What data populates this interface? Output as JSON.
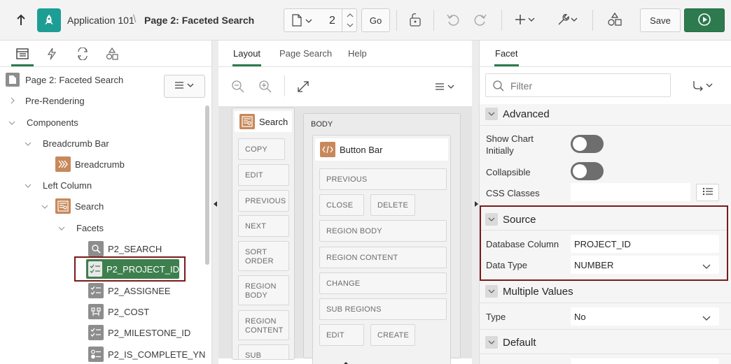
{
  "toolbar": {
    "app_name": "Application 101",
    "page_title": "Page 2: Faceted Search",
    "page_number": "2",
    "go_label": "Go",
    "save_label": "Save",
    "breadcrumb_sep": "\\"
  },
  "left_panel": {
    "root": "Page 2: Faceted Search",
    "nodes": {
      "pre_rendering": "Pre-Rendering",
      "components": "Components",
      "breadcrumb_bar": "Breadcrumb Bar",
      "breadcrumb": "Breadcrumb",
      "left_column": "Left Column",
      "search": "Search",
      "facets": "Facets",
      "f1": "P2_SEARCH",
      "f2": "P2_PROJECT_ID",
      "f3": "P2_ASSIGNEE",
      "f4": "P2_COST",
      "f5": "P2_MILESTONE_ID",
      "f6": "P2_IS_COMPLETE_YN"
    }
  },
  "middle_panel": {
    "tabs": [
      "Layout",
      "Page Search",
      "Help"
    ],
    "search_region": "Search",
    "search_slots": [
      "COPY",
      "EDIT",
      "PREVIOUS",
      "NEXT",
      "SORT ORDER",
      "REGION BODY",
      "REGION CONTENT",
      "SUB"
    ],
    "body_label": "BODY",
    "button_bar": "Button Bar",
    "bb_slots": {
      "previous": "PREVIOUS",
      "close": "CLOSE",
      "delete": "DELETE",
      "region_body": "REGION BODY",
      "region_content": "REGION CONTENT",
      "change": "CHANGE",
      "sub_regions": "SUB REGIONS",
      "edit": "EDIT",
      "create": "CREATE"
    }
  },
  "right_panel": {
    "tab": "Facet",
    "filter_placeholder": "Filter",
    "sections": {
      "advanced": "Advanced",
      "source": "Source",
      "multiple_values": "Multiple Values",
      "default": "Default"
    },
    "props": {
      "show_chart_initially": "Show Chart Initially",
      "collapsible": "Collapsible",
      "css_classes": "CSS Classes",
      "database_column": "Database Column",
      "database_column_value": "PROJECT_ID",
      "data_type": "Data Type",
      "data_type_value": "NUMBER",
      "type": "Type",
      "type_value": "No"
    }
  },
  "colors": {
    "accent_green": "#2d7a4e",
    "app_icon": "#1d9e95",
    "highlight": "#7a1a1a"
  }
}
